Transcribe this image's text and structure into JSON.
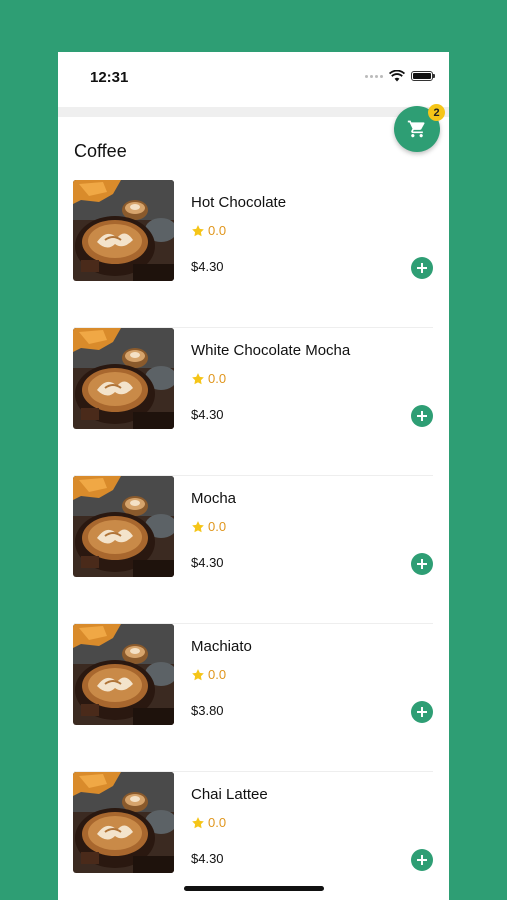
{
  "status_bar": {
    "time": "12:31"
  },
  "cart": {
    "count": "2"
  },
  "section": {
    "title": "Coffee"
  },
  "products": [
    {
      "name": "Hot Chocolate",
      "rating": "0.0",
      "price": "$4.30"
    },
    {
      "name": "White Chocolate Mocha",
      "rating": "0.0",
      "price": "$4.30"
    },
    {
      "name": "Mocha",
      "rating": "0.0",
      "price": "$4.30"
    },
    {
      "name": "Machiato",
      "rating": "0.0",
      "price": "$3.80"
    },
    {
      "name": "Chai Lattee",
      "rating": "0.0",
      "price": "$4.30"
    }
  ],
  "colors": {
    "brand": "#2e9e74",
    "star": "#f5c518",
    "rating_text": "#e0961d"
  },
  "icons": {
    "cart": "cart-icon",
    "add": "plus-circle-icon",
    "star": "star-icon"
  }
}
